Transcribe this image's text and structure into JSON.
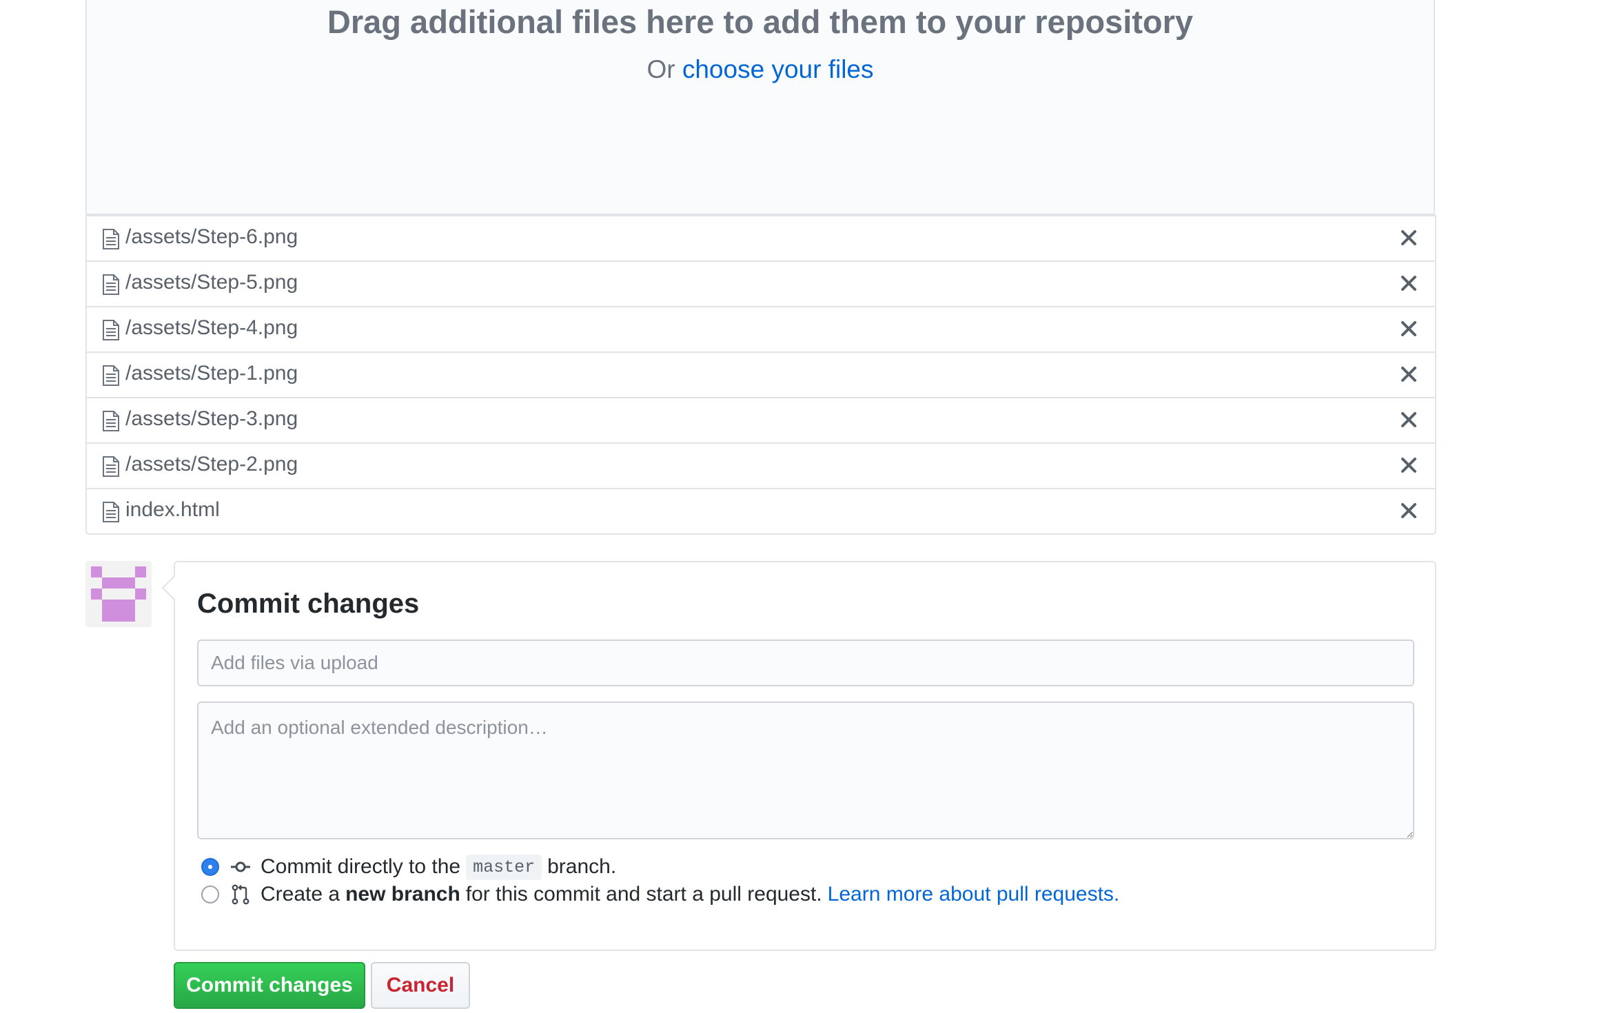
{
  "upload": {
    "title": "Drag additional files here to add them to your repository",
    "subtitle_prefix": "Or",
    "choose_link": "choose your files"
  },
  "files": [
    {
      "name": "/assets/Step-6.png"
    },
    {
      "name": "/assets/Step-5.png"
    },
    {
      "name": "/assets/Step-4.png"
    },
    {
      "name": "/assets/Step-1.png"
    },
    {
      "name": "/assets/Step-3.png"
    },
    {
      "name": "/assets/Step-2.png"
    },
    {
      "name": "index.html"
    }
  ],
  "commit": {
    "title": "Commit changes",
    "summary_placeholder": "Add files via upload",
    "description_placeholder": "Add an optional extended description…",
    "option_direct": {
      "prefix": "Commit directly to the",
      "branch": "master",
      "suffix": "branch.",
      "checked": true
    },
    "option_new_branch": {
      "prefix": "Create a",
      "bold": "new branch",
      "suffix": "for this commit and start a pull request.",
      "link": "Learn more about pull requests.",
      "checked": false
    },
    "submit_label": "Commit changes",
    "cancel_label": "Cancel"
  },
  "colors": {
    "link": "#0366d6",
    "primary_button": "#28a745",
    "cancel_text": "#cb2431",
    "avatar": "#cf8fdc",
    "radio_selected": "#2f80ed"
  }
}
